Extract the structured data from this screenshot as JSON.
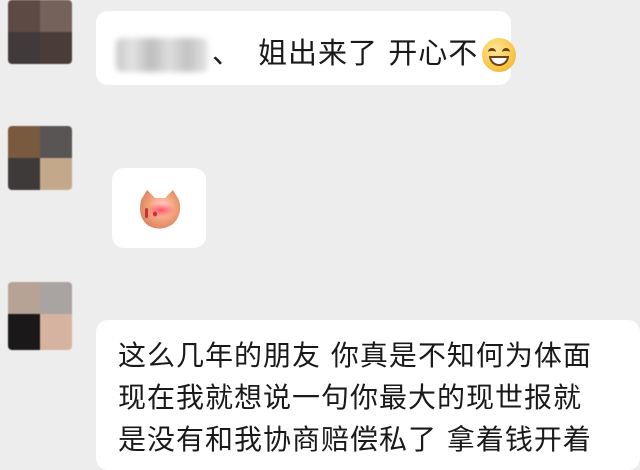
{
  "messages": [
    {
      "type": "text",
      "prefix": "、",
      "text": "姐出来了 开心不",
      "emoji": "grinning-face-emoji"
    },
    {
      "type": "sticker",
      "sticker": "kitty-sticker"
    },
    {
      "type": "text",
      "lines": [
        "这么几年的朋友 你真是不知何为体面",
        "现在我就想说一句你最大的现世报就",
        "是没有和我协商赔偿私了 拿着钱开着"
      ]
    }
  ],
  "colors": {
    "background": "#ededed",
    "bubble": "#ffffff",
    "text": "#191919"
  }
}
